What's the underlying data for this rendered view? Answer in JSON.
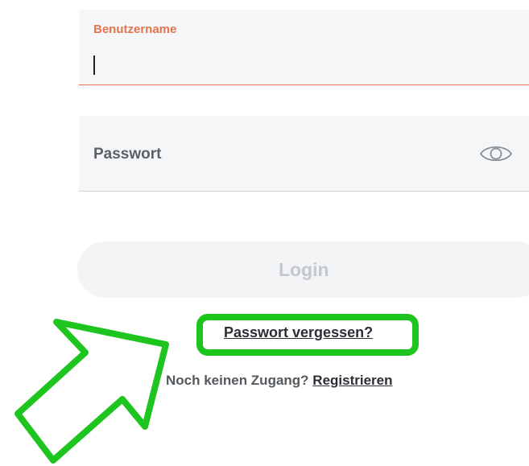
{
  "form": {
    "username": {
      "label": "Benutzername",
      "value": ""
    },
    "password": {
      "placeholder": "Passwort",
      "value": ""
    },
    "login_label": "Login",
    "forgot_password_label": "Passwort vergessen?",
    "no_account_text": "Noch keinen Zugang?",
    "register_label": "Registrieren"
  },
  "icons": {
    "password_toggle": "eye-icon"
  },
  "colors": {
    "accent": "#e4744a",
    "highlight": "#1ec51e",
    "field_bg": "#f5f6f7",
    "button_disabled_text": "#c4c8cc"
  }
}
